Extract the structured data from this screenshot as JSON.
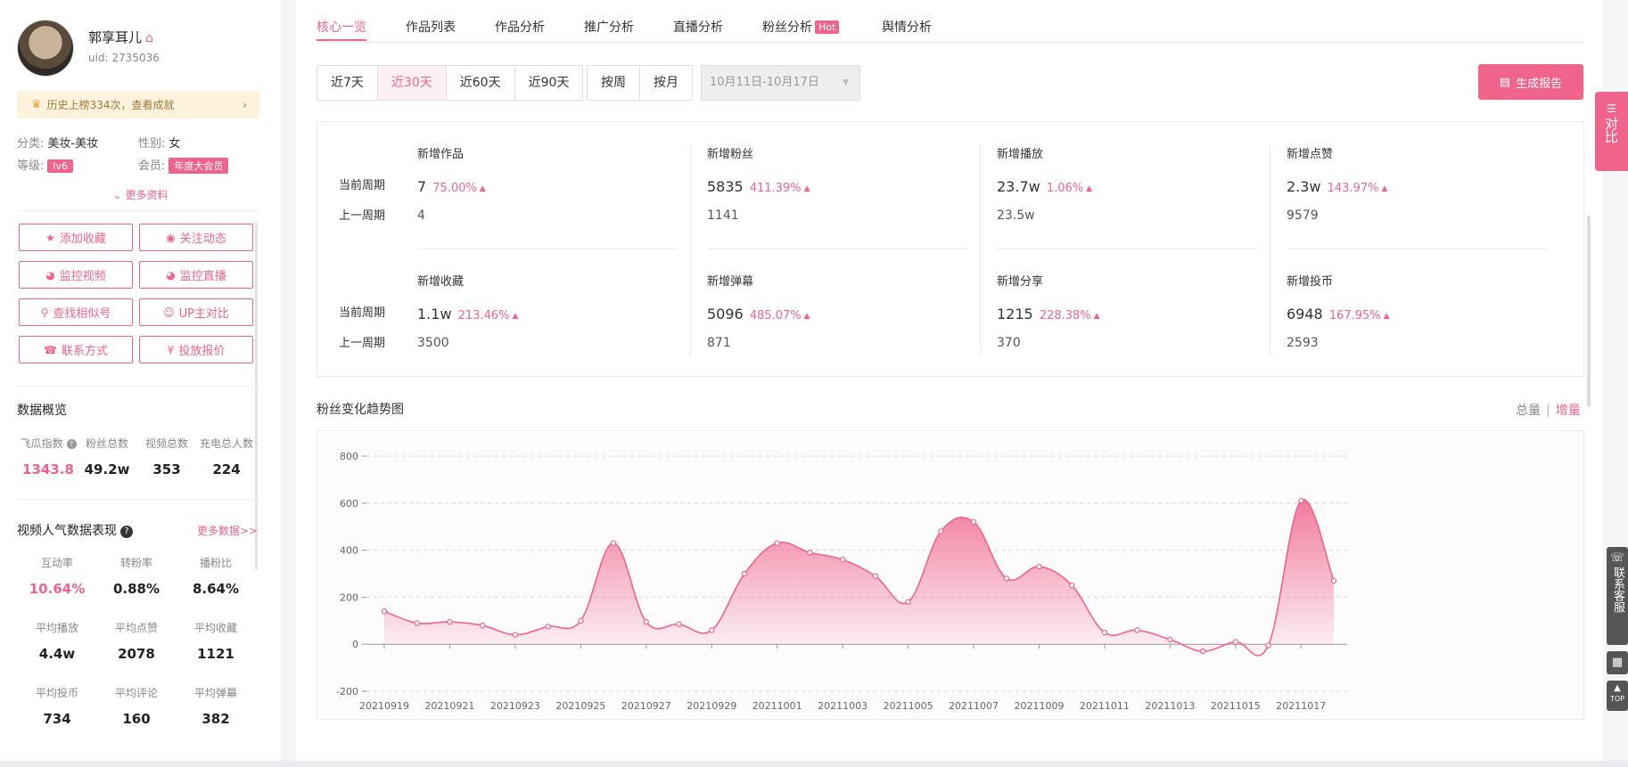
{
  "profile": {
    "name": "郭享耳儿",
    "uid": "uid: 2735036",
    "rank_text": "历史上榜334次，查看成就",
    "category_label": "分类:",
    "category_value": "美妆-美妆",
    "gender_label": "性别:",
    "gender_value": "女",
    "level_label": "等级:",
    "level_value": "lv6",
    "member_label": "会员:",
    "member_value": "年度大会员",
    "more_info": "更多资料"
  },
  "actions": [
    {
      "label": "添加收藏",
      "icon": "star-icon"
    },
    {
      "label": "关注动态",
      "icon": "eye-icon"
    },
    {
      "label": "监控视频",
      "icon": "monitor-icon"
    },
    {
      "label": "监控直播",
      "icon": "monitor-icon"
    },
    {
      "label": "查找相似号",
      "icon": "search-icon"
    },
    {
      "label": "UP主对比",
      "icon": "smile-icon"
    },
    {
      "label": "联系方式",
      "icon": "phone-icon"
    },
    {
      "label": "投放报价",
      "icon": "price-icon"
    }
  ],
  "overview": {
    "title": "数据概览",
    "items": [
      {
        "label": "飞瓜指数",
        "value": "1343.8"
      },
      {
        "label": "粉丝总数",
        "value": "49.2w"
      },
      {
        "label": "视频总数",
        "value": "353"
      },
      {
        "label": "充电总人数",
        "value": "224"
      }
    ]
  },
  "video_perf": {
    "title": "视频人气数据表现",
    "more": "更多数据>>",
    "items": [
      {
        "label": "互动率",
        "value": "10.64%"
      },
      {
        "label": "转粉率",
        "value": "0.88%"
      },
      {
        "label": "播粉比",
        "value": "8.64%"
      },
      {
        "label": "平均播放",
        "value": "4.4w"
      },
      {
        "label": "平均点赞",
        "value": "2078"
      },
      {
        "label": "平均收藏",
        "value": "1121"
      },
      {
        "label": "平均投币",
        "value": "734"
      },
      {
        "label": "平均评论",
        "value": "160"
      },
      {
        "label": "平均弹幕",
        "value": "382"
      }
    ]
  },
  "tabs": [
    "核心一览",
    "作品列表",
    "作品分析",
    "推广分析",
    "直播分析",
    "粉丝分析",
    "舆情分析"
  ],
  "hot_badge": "Hot",
  "range_buttons": [
    "近7天",
    "近30天",
    "近60天",
    "近90天"
  ],
  "period_buttons": [
    "按周",
    "按月"
  ],
  "date_range": "10月11日-10月17日",
  "report_button": "生成报告",
  "row_labels": {
    "current": "当前周期",
    "previous": "上一周期"
  },
  "metrics": [
    {
      "title": "新增作品",
      "current": "7",
      "pct": "75.00%",
      "previous": "4"
    },
    {
      "title": "新增粉丝",
      "current": "5835",
      "pct": "411.39%",
      "previous": "1141"
    },
    {
      "title": "新增播放",
      "current": "23.7w",
      "pct": "1.06%",
      "previous": "23.5w"
    },
    {
      "title": "新增点赞",
      "current": "2.3w",
      "pct": "143.97%",
      "previous": "9579"
    },
    {
      "title": "新增收藏",
      "current": "1.1w",
      "pct": "213.46%",
      "previous": "3500"
    },
    {
      "title": "新增弹幕",
      "current": "5096",
      "pct": "485.07%",
      "previous": "871"
    },
    {
      "title": "新增分享",
      "current": "1215",
      "pct": "228.38%",
      "previous": "370"
    },
    {
      "title": "新增投币",
      "current": "6948",
      "pct": "167.95%",
      "previous": "2593"
    }
  ],
  "chart_section": {
    "title": "粉丝变化趋势图",
    "toggle_total": "总量",
    "toggle_sep": "|",
    "toggle_incr": "增量"
  },
  "compare_float": "对比",
  "service_float": "联系客服",
  "top_float": "TOP",
  "colors": {
    "accent": "#f0648c"
  },
  "chart_data": {
    "type": "area",
    "x": [
      "20210919",
      "20210920",
      "20210921",
      "20210922",
      "20210923",
      "20210924",
      "20210925",
      "20210926",
      "20210927",
      "20210928",
      "20210929",
      "20210930",
      "20211001",
      "20211002",
      "20211003",
      "20211004",
      "20211005",
      "20211006",
      "20211007",
      "20211008",
      "20211009",
      "20211010",
      "20211011",
      "20211012",
      "20211013",
      "20211014",
      "20211015",
      "20211016",
      "20211017",
      "20211018"
    ],
    "x_tick_labels": [
      "20210919",
      "20210921",
      "20210923",
      "20210925",
      "20210927",
      "20210929",
      "20211001",
      "20211003",
      "20211005",
      "20211007",
      "20211009",
      "20211011",
      "20211013",
      "20211015",
      "20211017"
    ],
    "values": [
      140,
      90,
      95,
      80,
      40,
      75,
      100,
      430,
      95,
      85,
      60,
      300,
      430,
      390,
      360,
      290,
      180,
      480,
      520,
      280,
      330,
      250,
      50,
      60,
      20,
      -30,
      10,
      -5,
      610,
      270
    ],
    "ylim": [
      -200,
      800
    ],
    "yticks": [
      -200,
      0,
      200,
      400,
      600,
      800
    ],
    "grid": true,
    "legend": "none"
  }
}
